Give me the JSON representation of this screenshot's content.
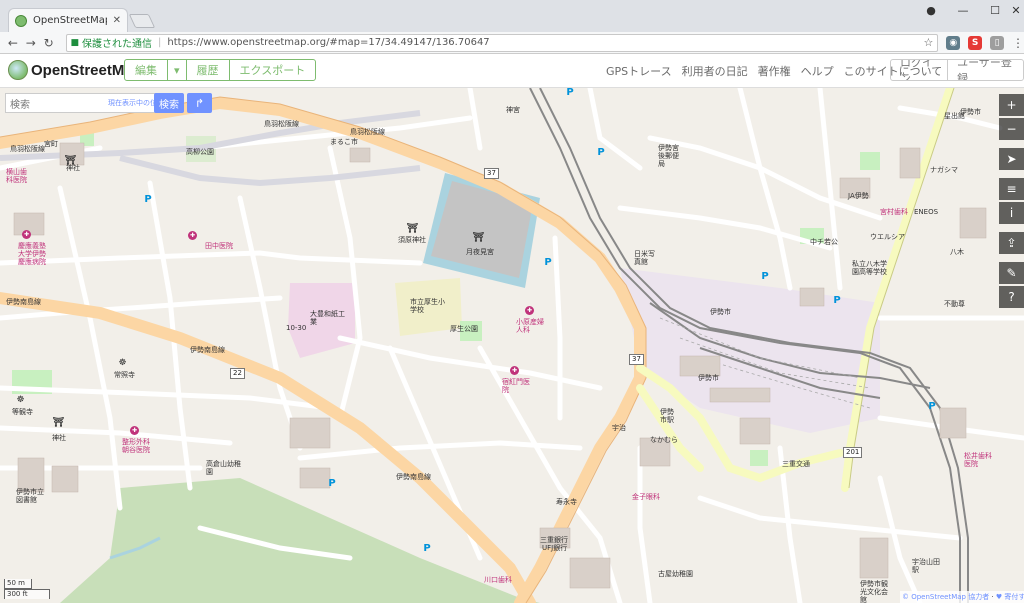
{
  "browser": {
    "tab_title": "OpenStreetMap",
    "secure_label": "保護された通信",
    "url": "https://www.openstreetmap.org/#map=17/34.49147/136.70647",
    "icons": [
      "back-icon",
      "forward-icon",
      "reload-icon",
      "lock-icon",
      "star-icon",
      "menu-icon"
    ]
  },
  "header": {
    "logo_text": "OpenStreetMap",
    "edit": "編集",
    "history": "履歴",
    "export": "エクスポート",
    "nav": [
      "GPSトレース",
      "利用者の日記",
      "著作権",
      "ヘルプ",
      "このサイトについて"
    ],
    "login": "ログイン",
    "signup": "ユーザー登録"
  },
  "search": {
    "placeholder": "検索",
    "where_is_this": "現在表示中の位置情報",
    "button": "検索"
  },
  "scale": {
    "metric": "50 m",
    "imperial": "300 ft"
  },
  "attribution": {
    "copyright": "© OpenStreetMap 協力者",
    "donate": "♥ 寄付する"
  },
  "map_labels": {
    "road_toba_matsusaka_1": "鳥羽松阪線",
    "road_toba_matsusaka_2": "鳥羽松阪線",
    "road_toba_matsusaka_3": "鳥羽松阪線",
    "road_ise_minami_1": "伊勢南島線",
    "road_ise_minami_2": "伊勢南島線",
    "road_ise_minami_3": "伊勢南島線",
    "route_37a": "37",
    "route_37b": "37",
    "route_22": "22",
    "route_201": "201",
    "geku": "月夜見宮",
    "sugawara": "須原神社",
    "elementary": "市立厚生小学校",
    "kosei_park": "厚生公園",
    "paper_factory": "大豊和紙工業",
    "hospital_yamada": "小原産婦人科",
    "hospital_chikuma": "宿紅門医院",
    "tanaka": "田中医院",
    "keio_hospital": "慶應義塾大学伊勢慶應病院",
    "hashimoto": "横山歯科医院",
    "miyamachi": "宮町",
    "kudan": "神社",
    "tomio": "高柳公園",
    "maruko": "まるこ市",
    "shrine_hosho": "宇治",
    "ise_city_station": "伊勢市駅",
    "ise_city": "伊勢市",
    "jokenji": "常照寺",
    "toganji": "等観寺",
    "jinja2": "神社",
    "ise_library": "伊勢市立図書館",
    "nagomi_ortho": "整形外科朝谷医院",
    "yamada_nursery": "高倉山幼稚園",
    "kaneko": "金子眼科",
    "sandai": "三重銀行",
    "ufj": "UFJ銀行",
    "yamamoto": "寿永寺",
    "naru": "なかむら",
    "iseshi_post": "伊勢宮後郵便局",
    "hoshide": "星出館",
    "natsume": "ナガシマ",
    "jabank": "JA伊勢",
    "miyamoto": "宮村歯科",
    "eneos": "ENEOS",
    "nakano": "中チ若公",
    "ise_hs": "私立八木学園高等学校",
    "welcia": "ウエルシア",
    "fudosha": "不動尊",
    "hakka": "八木",
    "matsui": "松井歯科医院",
    "ise_cultural": "伊勢市観光文化会館",
    "uji_station": "宇治山田駅",
    "kawaguchi": "川口歯科",
    "furugaya": "古屋幼稚園",
    "jinguu": "神宮",
    "miyagawa": "三重交通",
    "kane": "10-30",
    "yabusame": "伊勢市",
    "miyaji": "伊勢市",
    "shiho": "日米写真館"
  },
  "icons": {
    "zoom_in": "zoom-in-icon",
    "zoom_out": "zoom-out-icon",
    "geolocate": "locate-icon",
    "layers": "layers-icon",
    "legend": "info-icon",
    "share": "share-icon",
    "note": "note-icon",
    "query": "query-icon"
  }
}
